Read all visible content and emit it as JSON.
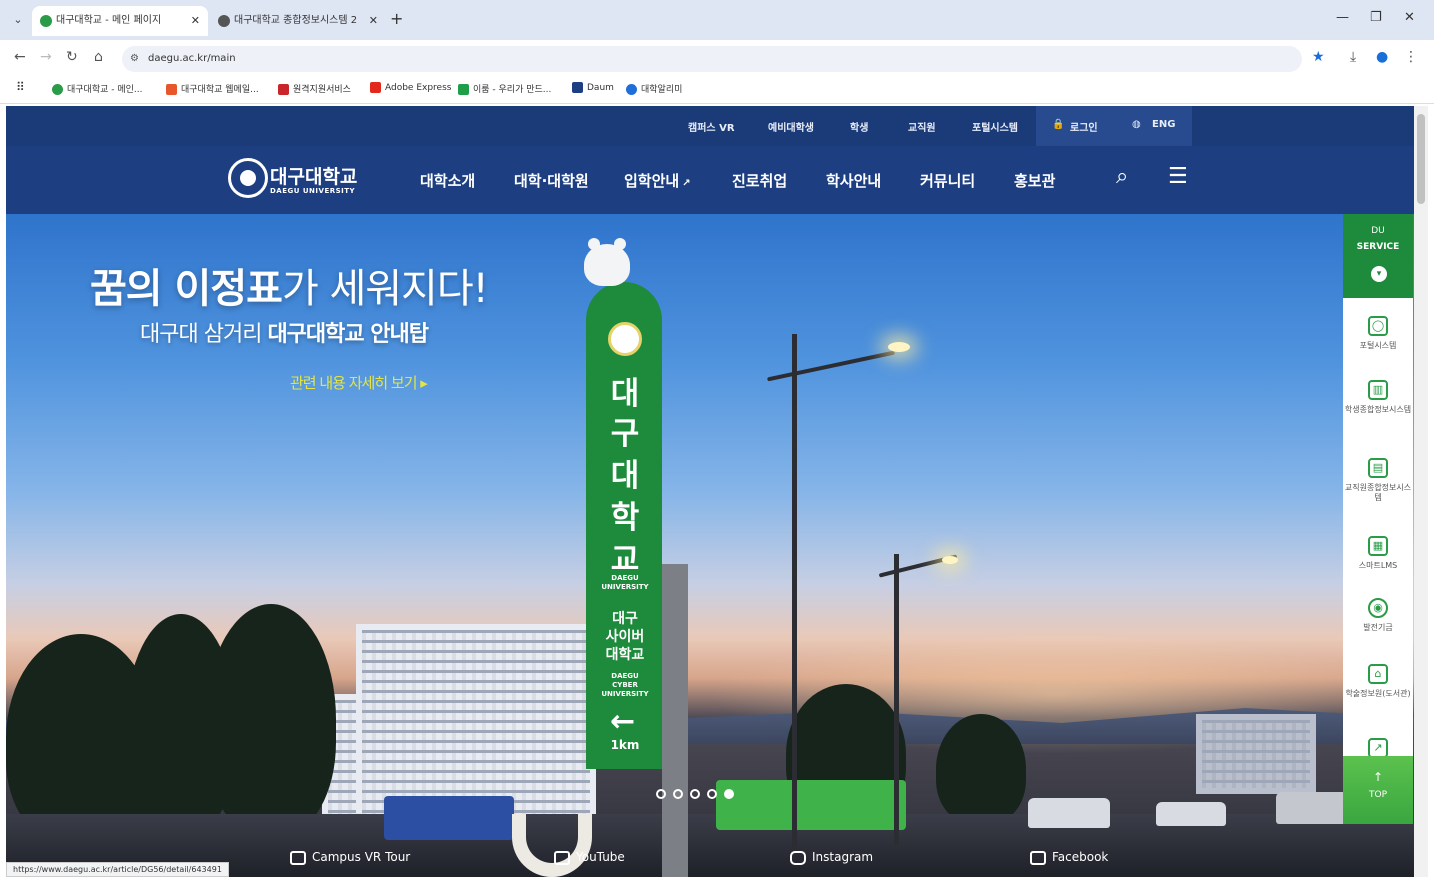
{
  "browser": {
    "tabs": [
      {
        "title": "대구대학교 - 메인 페이지",
        "active": true
      },
      {
        "title": "대구대학교 종합정보시스템 2",
        "active": false
      }
    ],
    "url": "daegu.ac.kr/main",
    "bookmarks": [
      {
        "label": "대구대학교 - 메인...",
        "color": "#2a9c48"
      },
      {
        "label": "대구대학교 웹메일...",
        "color": "#e8572a"
      },
      {
        "label": "원격지원서비스",
        "color": "#c8262b"
      },
      {
        "label": "Adobe Express",
        "color": "#e3271b"
      },
      {
        "label": "이룸 - 우리가 만드...",
        "color": "#1e9e49"
      },
      {
        "label": "Daum",
        "color": "#1d3f82"
      },
      {
        "label": "대학알리미",
        "color": "#1e6fd9"
      }
    ]
  },
  "site": {
    "util_links": [
      "캠퍼스 VR",
      "예비대학생",
      "학생",
      "교직원",
      "포털시스템"
    ],
    "login": "로그인",
    "lang": "ENG",
    "logo": {
      "name": "대구대학교",
      "sub": "DAEGU UNIVERSITY"
    },
    "menu": [
      "대학소개",
      "대학·대학원",
      "입학안내",
      "진로취업",
      "학사안내",
      "커뮤니티",
      "홍보관"
    ],
    "hero": {
      "title_bold": "꿈의 이정표",
      "title_rest": "가 세워지다!",
      "sub_plain": "대구대 삼거리 ",
      "sub_bold": "대구대학교 안내탑",
      "more": "관련 내용 자세히 보기 ▸"
    },
    "tower": {
      "chars": [
        "대",
        "구",
        "대",
        "학",
        "교"
      ],
      "univ_en_1": "DAEGU",
      "univ_en_2": "UNIVERSITY",
      "cyber_1": "대구",
      "cyber_2": "사이버",
      "cyber_3": "대학교",
      "cyber_en_1": "DAEGU",
      "cyber_en_2": "CYBER",
      "cyber_en_3": "UNIVERSITY",
      "arrow": "←",
      "distance": "1km"
    },
    "slider_count": 5,
    "slider_active": 5,
    "sns": [
      "Campus VR Tour",
      "YouTube",
      "Instagram",
      "Facebook"
    ],
    "quick": {
      "head_1": "DU",
      "head_2": "SERVICE",
      "items": [
        {
          "label": "포털시스템",
          "icon": "mouse-icon"
        },
        {
          "label": "학생종합정보시스템",
          "icon": "book-icon"
        },
        {
          "label": "교직원종합정보시스템",
          "icon": "briefcase-icon"
        },
        {
          "label": "스마트LMS",
          "icon": "board-icon"
        },
        {
          "label": "발전기금",
          "icon": "bulb-icon"
        },
        {
          "label": "학술정보원(도서관)",
          "icon": "library-icon"
        }
      ],
      "top": "TOP"
    },
    "status_url": "https://www.daegu.ac.kr/article/DG56/detail/643491"
  }
}
